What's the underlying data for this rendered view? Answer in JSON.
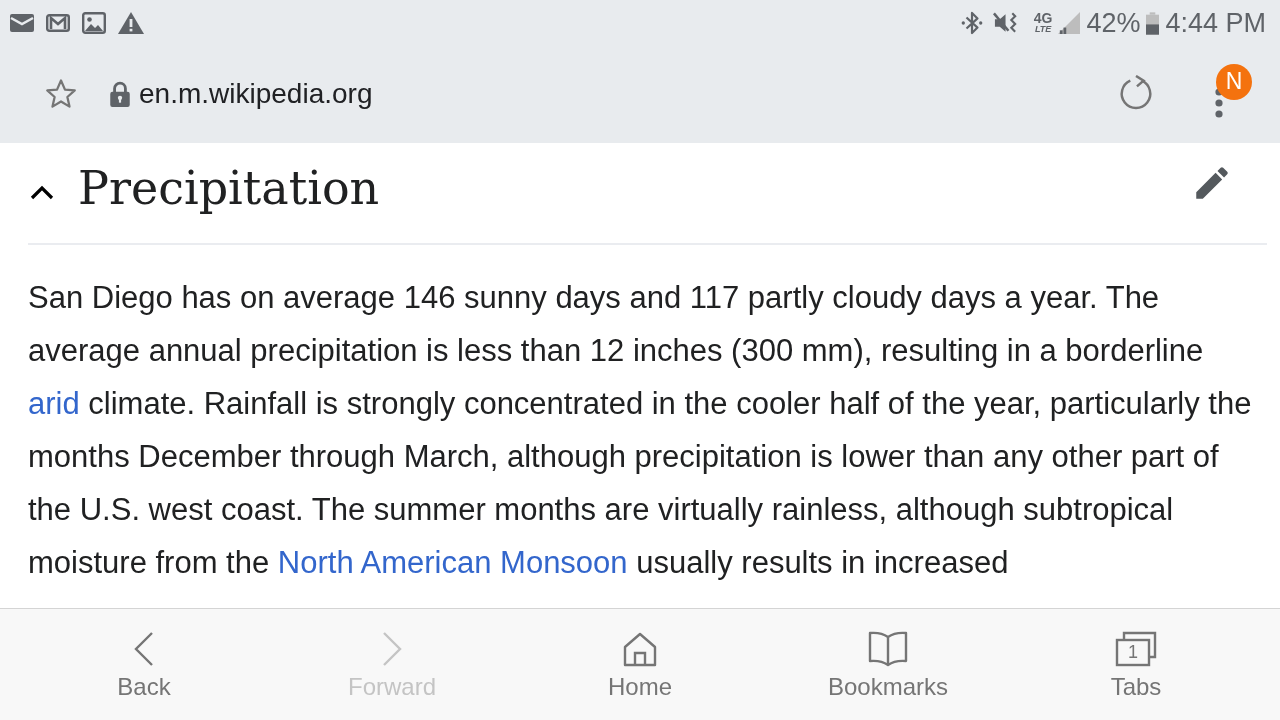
{
  "status_bar": {
    "network_label": "4G",
    "network_sublabel": "LTE",
    "battery_percent": "42%",
    "time": "4:44 PM"
  },
  "address_bar": {
    "url": "en.m.wikipedia.org",
    "account_badge": "N"
  },
  "section": {
    "title": "Precipitation",
    "expanded": true,
    "paragraph": [
      {
        "kind": "text",
        "text": "San Diego has on average 146 sunny days and 117 partly cloudy days a year. The average annual precipitation is less than 12 inches (300 mm), resulting in a borderline "
      },
      {
        "kind": "link",
        "text": "arid"
      },
      {
        "kind": "text",
        "text": " climate. Rainfall is strongly concentrated in the cooler half of the year, particularly the months December through March, although precipitation is lower than any other part of the U.S. west coast. The summer months are virtually rainless, although subtropical moisture from the "
      },
      {
        "kind": "link",
        "text": "North American Monsoon"
      },
      {
        "kind": "text",
        "text": " usually results in increased"
      }
    ]
  },
  "bottom_nav": [
    {
      "kind": "back",
      "label": "Back",
      "disabled": false
    },
    {
      "kind": "forward",
      "label": "Forward",
      "disabled": true
    },
    {
      "kind": "home",
      "label": "Home",
      "disabled": false
    },
    {
      "kind": "bookmarks",
      "label": "Bookmarks",
      "disabled": false
    },
    {
      "kind": "tabs",
      "label": "Tabs",
      "disabled": false,
      "count": "1"
    }
  ]
}
